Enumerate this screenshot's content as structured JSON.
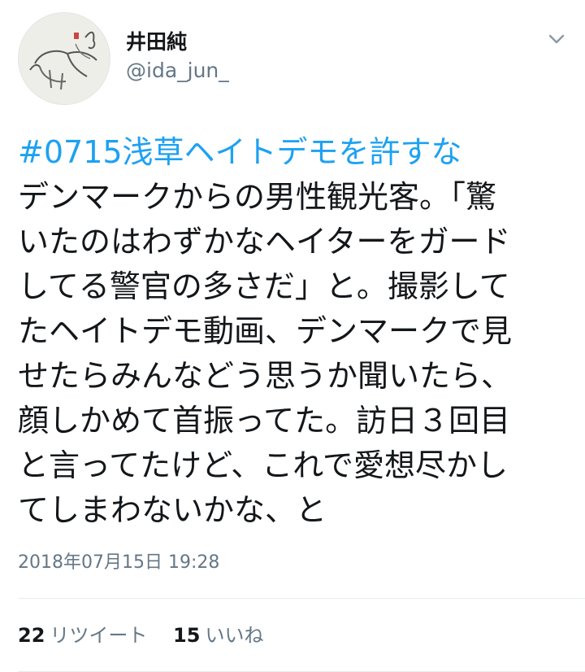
{
  "author": {
    "display_name": "井田純",
    "handle": "@ida_jun_",
    "avatar_icon": "ink-sketch-dog-avatar"
  },
  "menu_icon": "chevron-down-icon",
  "tweet": {
    "hashtag": "#0715浅草ヘイトデモを許すな",
    "lines": [
      "デンマークからの男性観光客。「驚",
      "いたのはわずかなヘイターをガード",
      "してる警官の多さだ」と。撮影して",
      "たヘイトデモ動画、デンマークで見",
      "せたらみんなどう思うか聞いたら、",
      "顔しかめて首振ってた。訪日３回目",
      "と言ってたけど、これで愛想尽かし",
      "てしまわないかな、と"
    ],
    "timestamp": "2018年07月15日 19:28"
  },
  "stats": {
    "retweets_count": "22",
    "retweets_label": "リツイート",
    "likes_count": "15",
    "likes_label": "いいね"
  },
  "colors": {
    "link": "#1da1f2",
    "text": "#14171a",
    "secondary": "#657786"
  }
}
